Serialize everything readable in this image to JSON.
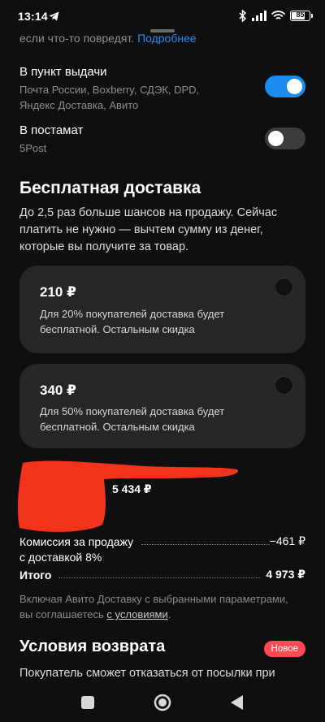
{
  "status_bar": {
    "time": "13:14",
    "battery": "85"
  },
  "top_cut_text": {
    "text": "если что-то повредят.",
    "link": "Подробнее"
  },
  "delivery_options": [
    {
      "title": "В пункт выдачи",
      "subtitle_line1": "Почта России, Boxberry, СДЭК, DPD,",
      "subtitle_line2": "Яндекс Доставка, Авито",
      "enabled": true
    },
    {
      "title": "В постамат",
      "subtitle_line1": "5Post",
      "enabled": false
    }
  ],
  "free_delivery": {
    "title": "Бесплатная доставка",
    "description": "До 2,5 раз больше шансов на продажу. Сейчас платить не нужно — вычтем сумму из денег, которые вы получите за товар.",
    "cards": [
      {
        "price": "210 ₽",
        "desc": "Для 20% покупателей доставка будет бесплатной. Остальным скидка"
      },
      {
        "price": "340 ₽",
        "desc": "Для 50% покупателей доставка будет бесплатной. Остальным скидка"
      }
    ]
  },
  "summary": {
    "received_amount": "5 434 ₽",
    "commission_label_line1": "Комиссия за продажу",
    "commission_label_line2": "с доставкой 8%",
    "commission_value": "−461 ₽",
    "total_label": "Итого",
    "total_value": "4 973 ₽"
  },
  "agreement": {
    "line1": "Включая Авито Доставку с выбранными параметрами,",
    "line2_prefix": "вы соглашаетесь ",
    "link": "с условиями",
    "line2_suffix": "."
  },
  "return_terms": {
    "title": "Условия возврата",
    "badge": "Новое",
    "text": "Покупатель сможет отказаться от посылки при"
  },
  "colors": {
    "accent": "#1a8cf0",
    "badge": "#ff4a55",
    "card": "#262626",
    "background": "#0f0f0f"
  }
}
